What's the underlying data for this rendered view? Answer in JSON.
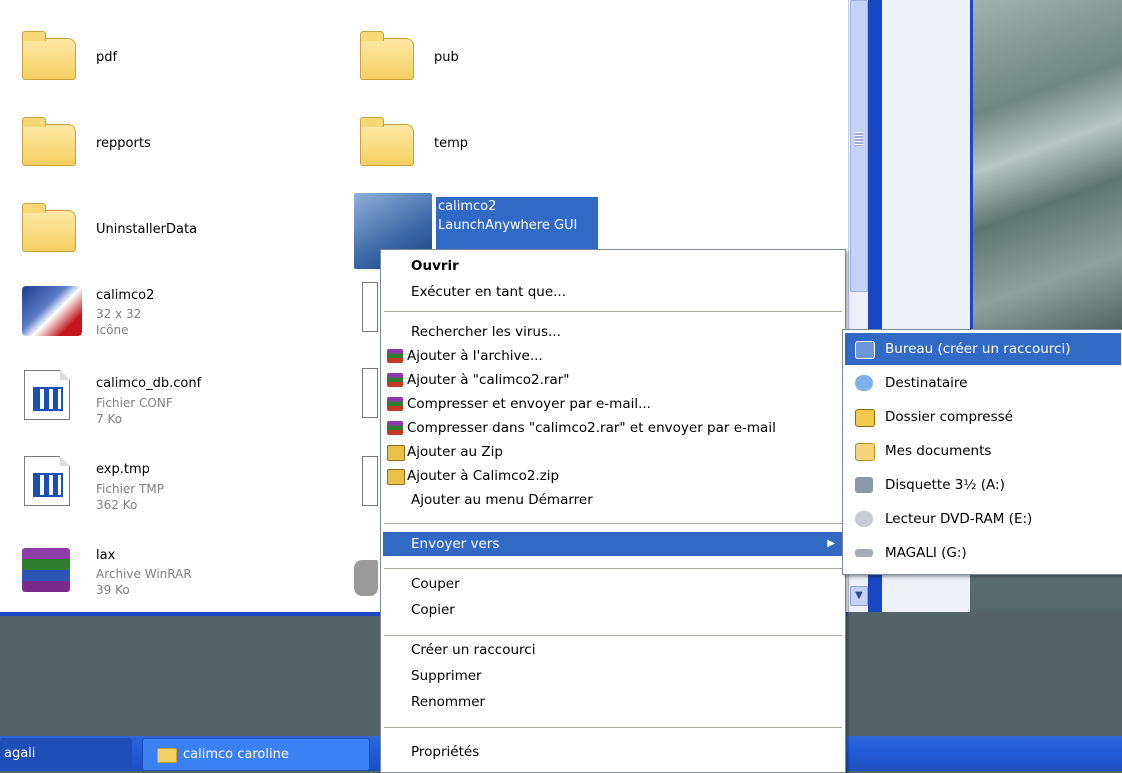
{
  "files": [
    {
      "name": "pdf"
    },
    {
      "name": "pub"
    },
    {
      "name": "repports"
    },
    {
      "name": "temp"
    },
    {
      "name": "UninstallerData"
    },
    {
      "name": "calimco2",
      "line2": "32 x 32",
      "line3": "Icône"
    },
    {
      "name": "calimco_db.conf",
      "line2": "Fichier CONF",
      "line3": "7 Ko"
    },
    {
      "name": "exp.tmp",
      "line2": "Fichier TMP",
      "line3": "362 Ko"
    },
    {
      "name": "lax",
      "line2": "Archive WinRAR",
      "line3": "39 Ko"
    }
  ],
  "selected_file": {
    "line1": "calimco2",
    "line2": "LaunchAnywhere GUI"
  },
  "context_menu": {
    "items": [
      "Ouvrir",
      "Exécuter en tant que...",
      "Rechercher les virus...",
      "Ajouter à l'archive...",
      "Ajouter à \"calimco2.rar\"",
      "Compresser et envoyer par e-mail...",
      "Compresser dans \"calimco2.rar\" et envoyer par e-mail",
      "Ajouter au Zip",
      "Ajouter à Calimco2.zip",
      "Ajouter au menu Démarrer",
      "Envoyer vers",
      "Couper",
      "Copier",
      "Créer un raccourci",
      "Supprimer",
      "Renommer",
      "Propriétés"
    ]
  },
  "send_to_menu": {
    "items": [
      "Bureau (créer un raccourci)",
      "Destinataire",
      "Dossier compressé",
      "Mes documents",
      "Disquette 3½ (A:)",
      "Lecteur DVD-RAM (E:)",
      "MAGALI (G:)"
    ]
  },
  "taskbar": {
    "btn1": "agali",
    "btn2": "calimco caroline"
  },
  "colors": {
    "selection": "#316ac5",
    "taskbar": "#245edb",
    "menu_bg": "#ffffff"
  }
}
